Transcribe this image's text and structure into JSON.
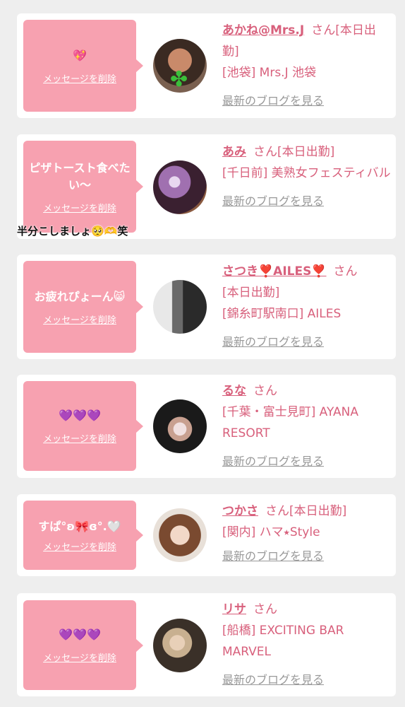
{
  "delete_label": "メッセージを削除",
  "blog_label": "最新のブログを見る",
  "overlay_text": "半分こしましょ🥺🫶笑",
  "cards": [
    {
      "message": "💖",
      "name": "あかね@Mrs.J",
      "san": "さん",
      "status": "[本日出勤]",
      "location": "[池袋] Mrs.J 池袋"
    },
    {
      "message": "ピザトースト食べたい〜",
      "name": "あみ",
      "san": "さん",
      "status": "[本日出勤]",
      "location": "[千日前] 美熟女フェスティバル"
    },
    {
      "message": "お疲れぴょーん😸",
      "name": "さつき❣️AILES❣️",
      "san": "さん",
      "status": "[本日出勤]",
      "location": "[錦糸町駅南口] AILES"
    },
    {
      "message": "💜💜💜",
      "name": "るな",
      "san": "さん",
      "status": "",
      "location": "[千葉・富士見町] AYANA RESORT"
    },
    {
      "message": "すぱ°ʚ🎀ɞ°.🤍",
      "name": "つかさ",
      "san": "さん",
      "status": "[本日出勤]",
      "location": "[関内] ハマ⭑Style"
    },
    {
      "message": "💜💜💜",
      "name": "リサ",
      "san": "さん",
      "status": "",
      "location": "[船橋] EXCITING BAR MARVEL"
    }
  ]
}
